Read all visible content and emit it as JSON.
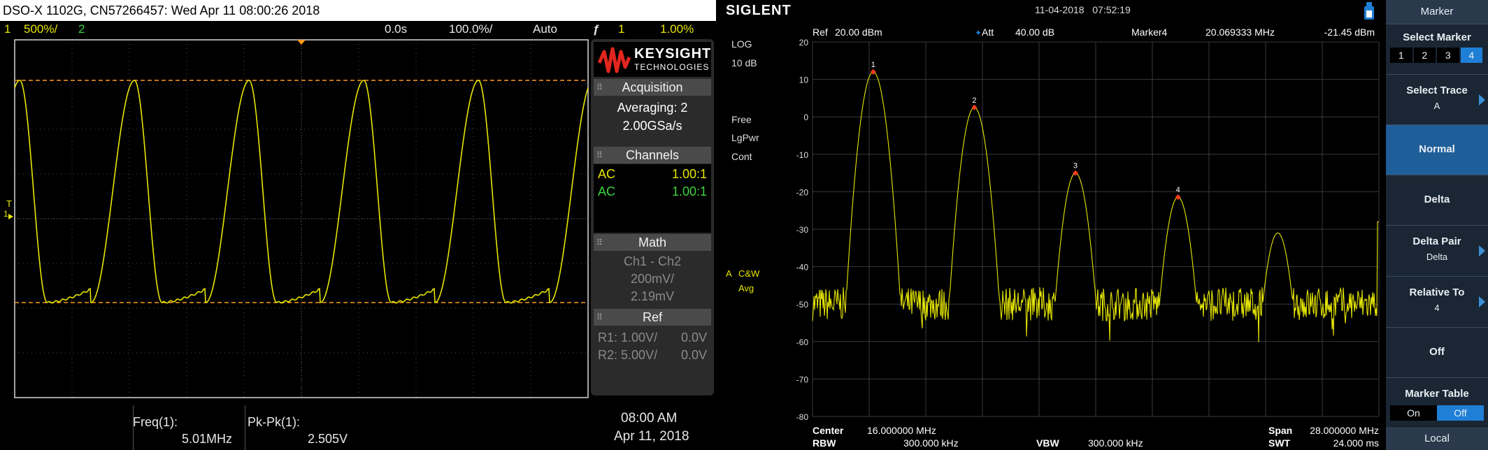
{
  "scope": {
    "title": "DSO-X 1102G, CN57266457: Wed Apr 11 08:00:26 2018",
    "status": {
      "ch1_num": "1",
      "ch1_scale": "500%/",
      "ch2_num": "2",
      "time_offset": "0.0s",
      "time_scale": "100.0%/",
      "trigger_mode": "Auto",
      "trigger_icon": "trigger-edge-icon",
      "trigger_source": "1",
      "trigger_level": "1.00%"
    },
    "trigger_marker": "T",
    "ground_marker": "1",
    "brand": {
      "name": "KEYSIGHT",
      "sub": "TECHNOLOGIES",
      "logo_color": "#e2261e"
    },
    "acquisition": {
      "header": "Acquisition",
      "mode": "Averaging: 2",
      "rate": "2.00GSa/s"
    },
    "channels": {
      "header": "Channels",
      "rows": [
        {
          "coupling": "AC",
          "probe": "1.00:1",
          "color": "#e6e600"
        },
        {
          "coupling": "AC",
          "probe": "1.00:1",
          "color": "#3cd43c"
        }
      ]
    },
    "math": {
      "header": "Math",
      "expr": "Ch1 - Ch2",
      "scale": "200mV/",
      "offset": "2.19mV"
    },
    "ref": {
      "header": "Ref",
      "rows": [
        {
          "label": "R1:",
          "scale": "1.00V/",
          "offset": "0.0V"
        },
        {
          "label": "R2:",
          "scale": "5.00V/",
          "offset": "0.0V"
        }
      ]
    },
    "measurements": [
      {
        "label": "Freq(1):",
        "value": "5.01MHz"
      },
      {
        "label": "Pk-Pk(1):",
        "value": "2.505V"
      }
    ],
    "clock": {
      "time": "08:00 AM",
      "date": "Apr 11, 2018"
    },
    "colors": {
      "ch1": "#e6e600",
      "cursor": "#ff9a1a",
      "grid": "#4d4d4d"
    }
  },
  "sa": {
    "brand": "SIGLENT",
    "date": "11-04-2018",
    "time": "07:52:19",
    "header": {
      "ref_label": "Ref",
      "ref_value": "20.00 dBm",
      "att_label": "Att",
      "att_value": "40.00 dB",
      "marker_label": "Marker4",
      "marker_freq": "20.069333 MHz",
      "marker_level": "-21.45 dBm"
    },
    "left_labels": [
      "LOG",
      "10 dB",
      "Free",
      "LgPwr",
      "Cont"
    ],
    "trace_info": {
      "label": "A",
      "detector": "C&W",
      "mode": "Avg"
    },
    "y_ticks": [
      "20",
      "10",
      "0",
      "-10",
      "-20",
      "-30",
      "-40",
      "-50",
      "-60",
      "-70",
      "-80"
    ],
    "markers": [
      {
        "id": "1",
        "freq_mhz": 5.0,
        "level_dbm": 12
      },
      {
        "id": "2",
        "freq_mhz": 10.0,
        "level_dbm": 2.5
      },
      {
        "id": "3",
        "freq_mhz": 15.0,
        "level_dbm": -15
      },
      {
        "id": "4",
        "freq_mhz": 20.069333,
        "level_dbm": -21.45
      }
    ],
    "extra_peak": {
      "freq_mhz": 25.0,
      "level_dbm": -31
    },
    "noise_floor_dbm": -50,
    "footer": {
      "center_label": "Center",
      "center_value": "16.000000 MHz",
      "span_label": "Span",
      "span_value": "28.000000 MHz",
      "rbw_label": "RBW",
      "rbw_value": "300.000 kHz",
      "vbw_label": "VBW",
      "vbw_value": "300.000 kHz",
      "swt_label": "SWT",
      "swt_value": "24.000 ms"
    },
    "softkeys": {
      "title": "Marker",
      "select_marker": "Select Marker",
      "marker_numbers": [
        "1",
        "2",
        "3",
        "4"
      ],
      "selected_marker": "4",
      "select_trace": "Select Trace",
      "select_trace_value": "A",
      "normal": "Normal",
      "delta": "Delta",
      "delta_pair": "Delta Pair",
      "delta_pair_value": "Delta",
      "relative_to": "Relative To",
      "relative_to_value": "4",
      "off": "Off",
      "marker_table": "Marker Table",
      "on_label": "On",
      "off_label": "Off",
      "local": "Local"
    },
    "colors": {
      "trace": "#e6e600",
      "marker": "#ff3b1f",
      "grid": "#3a3a3a",
      "active_key": "#1f5f99"
    }
  }
}
